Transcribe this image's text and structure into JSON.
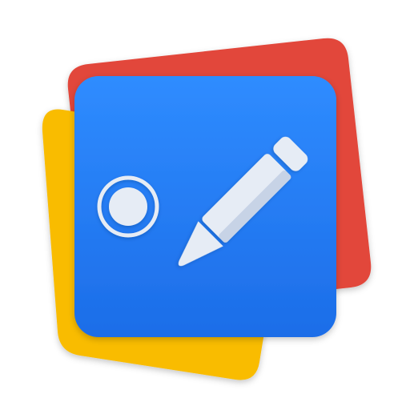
{
  "icon": {
    "name": "screen-recorder-and-annotation-app-icon",
    "glyphs": [
      "record-icon",
      "pencil-icon"
    ],
    "colors": {
      "back_card": "#e2463a",
      "middle_card": "#f9bc00",
      "front_card_top": "#2f8cff",
      "front_card_bottom": "#1c6de8",
      "glyph": "#e6ecf5",
      "glyph_shadow": "#c7d3e6",
      "background": "#ffffff"
    }
  }
}
